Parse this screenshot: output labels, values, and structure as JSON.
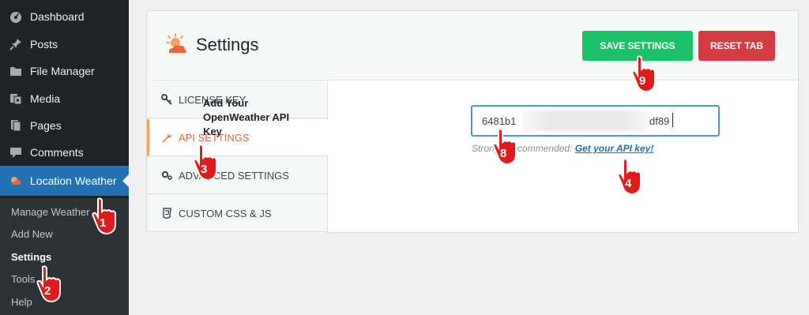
{
  "sidebar": {
    "items": [
      {
        "label": "Dashboard",
        "icon": "dashboard-icon"
      },
      {
        "label": "Posts",
        "icon": "pin-icon"
      },
      {
        "label": "File Manager",
        "icon": "folder-icon"
      },
      {
        "label": "Media",
        "icon": "media-icon"
      },
      {
        "label": "Pages",
        "icon": "pages-icon"
      },
      {
        "label": "Comments",
        "icon": "comment-icon"
      },
      {
        "label": "Location Weather",
        "icon": "weather-icon"
      }
    ],
    "submenu": [
      "Manage Weather",
      "Add New",
      "Settings",
      "Tools",
      "Help"
    ]
  },
  "header": {
    "title": "Settings",
    "save_label": "SAVE SETTINGS",
    "reset_label": "RESET TAB"
  },
  "tabs": [
    {
      "label": "LICENSE KEY"
    },
    {
      "label": "API SETTINGS"
    },
    {
      "label": "ADVANCED SETTINGS"
    },
    {
      "label": "CUSTOM CSS & JS"
    }
  ],
  "field": {
    "label": "Add Your OpenWeather API Key",
    "value": "6481b1",
    "value_end": "df89",
    "help_prefix": "Strongly recommended: ",
    "help_link": "Get your API key!"
  },
  "markers": [
    "1",
    "2",
    "3",
    "8",
    "4",
    "9"
  ],
  "colors": {
    "sidebar_bg": "#1d2327",
    "active_menu": "#2271b1",
    "save_button": "#1ec068",
    "reset_button": "#d23d44",
    "active_tab": "#e8663d",
    "marker": "#e01b1b"
  }
}
